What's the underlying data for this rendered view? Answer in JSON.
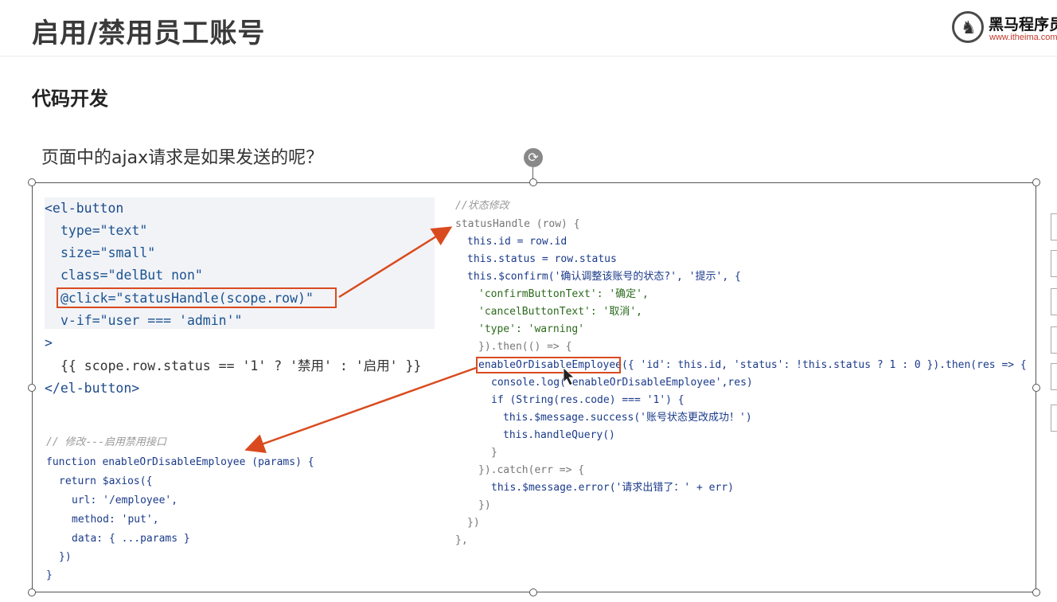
{
  "header": {
    "title": "启用/禁用员工账号",
    "logo_name": "黑马程序员",
    "logo_url": "www.itheima.com"
  },
  "subtitle": "代码开发",
  "question": "页面中的ajax请求是如果发送的呢？",
  "template_code": {
    "line1_tag_open": "<el-button",
    "line2": "type=\"text\"",
    "line3": "size=\"small\"",
    "line4": "class=\"delBut non\"",
    "line5": "@click=\"statusHandle(scope.row)\"",
    "line6": "v-if=\"user === 'admin'\"",
    "line7": ">",
    "line8": "{{ scope.row.status == '1' ? '禁用' : '启用' }}",
    "line9": "</el-button>"
  },
  "api_code": {
    "comment": "// 修改---启用禁用接口",
    "line1": "function enableOrDisableEmployee (params) {",
    "line2": "return $axios({",
    "line3": "url: '/employee',",
    "line4": "method: 'put',",
    "line5": "data: { ...params }",
    "line6": "})",
    "line7": "}"
  },
  "handler_code": {
    "comment": "//状态修改",
    "line1": "statusHandle (row) {",
    "line2": "this.id = row.id",
    "line3": "this.status = row.status",
    "line4": "this.$confirm('确认调整该账号的状态?', '提示', {",
    "line5": "'confirmButtonText': '确定',",
    "line6": "'cancelButtonText': '取消',",
    "line7": "'type': 'warning'",
    "line8": "}).then(() => {",
    "line9": "enableOrDisableEmployee({ 'id': this.id, 'status': !this.status ? 1 : 0 }).then(res => {",
    "line10": "console.log('enableOrDisableEmployee',res)",
    "line11": "if (String(res.code) === '1') {",
    "line12": "this.$message.success('账号状态更改成功！')",
    "line13": "this.handleQuery()",
    "line14": "}",
    "line15": "}).catch(err => {",
    "line16": "this.$message.error('请求出错了：' + err)",
    "line17": "})",
    "line18": "})",
    "line19": "},"
  },
  "colors": {
    "annotation_red": "#d94b1f",
    "highlight": "#fbeccf"
  },
  "icons": [
    "rotate-icon",
    "horse-logo-icon",
    "mouse-cursor-icon"
  ]
}
